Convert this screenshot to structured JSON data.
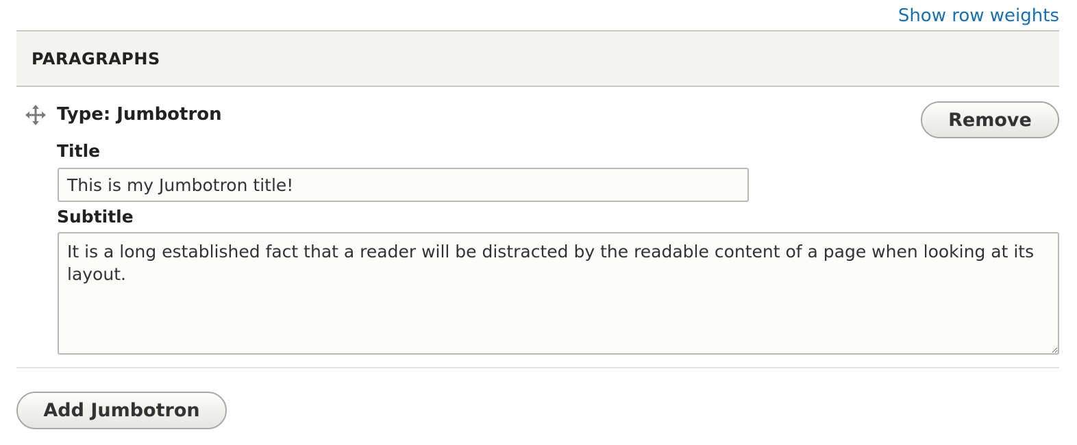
{
  "header_links": {
    "show_row_weights": "Show row weights"
  },
  "table": {
    "header_label": "PARAGRAPHS"
  },
  "paragraph_item": {
    "drag_icon": "move-arrows-icon",
    "type_label": "Type: Jumbotron",
    "remove_label": "Remove",
    "fields": {
      "title": {
        "label": "Title",
        "value": "This is my Jumbotron title!"
      },
      "subtitle": {
        "label": "Subtitle",
        "value": "It is a long established fact that a reader will be distracted by the readable content of a page when looking at its layout."
      }
    }
  },
  "actions": {
    "add_label": "Add Jumbotron"
  },
  "colors": {
    "link": "#1a6fb0",
    "header_bg": "#f3f3ef",
    "border": "#c6c6c2",
    "text": "#232323"
  }
}
